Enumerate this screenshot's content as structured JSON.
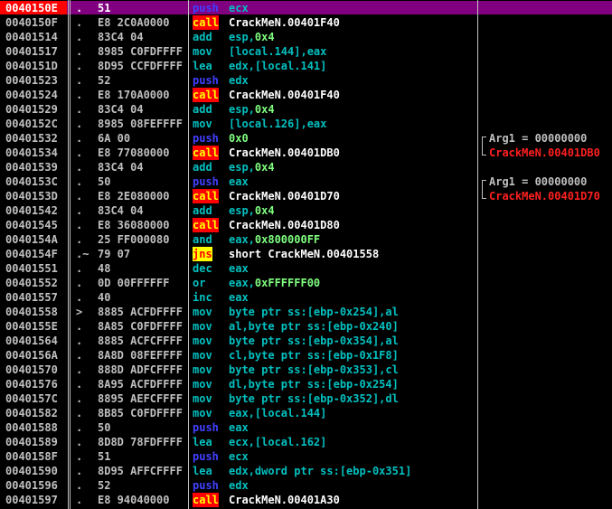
{
  "colors": {
    "background": "#000000",
    "selected_row": "#800080",
    "selected_address": "#ff0000",
    "call_highlight": "#ff0000",
    "jump_highlight": "#ffff00"
  },
  "rows": [
    {
      "addr": "0040150E",
      "mark": ".",
      "hex": "51",
      "mn": "push",
      "ops": [
        {
          "t": "ecx",
          "k": "reg"
        }
      ],
      "kind": "push",
      "selected": true
    },
    {
      "addr": "0040150F",
      "mark": ".",
      "hex": "E8 2C0A0000",
      "mn": "call",
      "ops": [
        {
          "t": "CrackMeN.00401F40",
          "k": "txt"
        }
      ],
      "kind": "call"
    },
    {
      "addr": "00401514",
      "mark": ".",
      "hex": "83C4 04",
      "mn": "add",
      "ops": [
        {
          "t": "esp,",
          "k": "reg"
        },
        {
          "t": "0x4",
          "k": "imm"
        }
      ],
      "kind": "add"
    },
    {
      "addr": "00401517",
      "mark": ".",
      "hex": "8985 C0FDFFFF",
      "mn": "mov",
      "ops": [
        {
          "t": "[local.144],",
          "k": "mem"
        },
        {
          "t": "eax",
          "k": "reg"
        }
      ],
      "kind": "mov"
    },
    {
      "addr": "0040151D",
      "mark": ".",
      "hex": "8D95 CCFDFFFF",
      "mn": "lea",
      "ops": [
        {
          "t": "edx,[local.141]",
          "k": "reg"
        }
      ],
      "kind": "lea"
    },
    {
      "addr": "00401523",
      "mark": ".",
      "hex": "52",
      "mn": "push",
      "ops": [
        {
          "t": "edx",
          "k": "reg"
        }
      ],
      "kind": "push"
    },
    {
      "addr": "00401524",
      "mark": ".",
      "hex": "E8 170A0000",
      "mn": "call",
      "ops": [
        {
          "t": "CrackMeN.00401F40",
          "k": "txt"
        }
      ],
      "kind": "call"
    },
    {
      "addr": "00401529",
      "mark": ".",
      "hex": "83C4 04",
      "mn": "add",
      "ops": [
        {
          "t": "esp,",
          "k": "reg"
        },
        {
          "t": "0x4",
          "k": "imm"
        }
      ],
      "kind": "add"
    },
    {
      "addr": "0040152C",
      "mark": ".",
      "hex": "8985 08FEFFFF",
      "mn": "mov",
      "ops": [
        {
          "t": "[local.126],",
          "k": "mem"
        },
        {
          "t": "eax",
          "k": "reg"
        }
      ],
      "kind": "mov"
    },
    {
      "addr": "00401532",
      "mark": ".",
      "hex": "6A 00",
      "mn": "push",
      "ops": [
        {
          "t": "0x0",
          "k": "imm"
        }
      ],
      "kind": "push"
    },
    {
      "addr": "00401534",
      "mark": ".",
      "hex": "E8 77080000",
      "mn": "call",
      "ops": [
        {
          "t": "CrackMeN.00401DB0",
          "k": "txt"
        }
      ],
      "kind": "call"
    },
    {
      "addr": "00401539",
      "mark": ".",
      "hex": "83C4 04",
      "mn": "add",
      "ops": [
        {
          "t": "esp,",
          "k": "reg"
        },
        {
          "t": "0x4",
          "k": "imm"
        }
      ],
      "kind": "add"
    },
    {
      "addr": "0040153C",
      "mark": ".",
      "hex": "50",
      "mn": "push",
      "ops": [
        {
          "t": "eax",
          "k": "reg"
        }
      ],
      "kind": "push"
    },
    {
      "addr": "0040153D",
      "mark": ".",
      "hex": "E8 2E080000",
      "mn": "call",
      "ops": [
        {
          "t": "CrackMeN.00401D70",
          "k": "txt"
        }
      ],
      "kind": "call"
    },
    {
      "addr": "00401542",
      "mark": ".",
      "hex": "83C4 04",
      "mn": "add",
      "ops": [
        {
          "t": "esp,",
          "k": "reg"
        },
        {
          "t": "0x4",
          "k": "imm"
        }
      ],
      "kind": "add"
    },
    {
      "addr": "00401545",
      "mark": ".",
      "hex": "E8 36080000",
      "mn": "call",
      "ops": [
        {
          "t": "CrackMeN.00401D80",
          "k": "txt"
        }
      ],
      "kind": "call"
    },
    {
      "addr": "0040154A",
      "mark": ".",
      "hex": "25 FF000080",
      "mn": "and",
      "ops": [
        {
          "t": "eax,",
          "k": "reg"
        },
        {
          "t": "0x800000FF",
          "k": "imm"
        }
      ],
      "kind": "and"
    },
    {
      "addr": "0040154F",
      "mark": ".~",
      "hex": "79 07",
      "mn": "jns",
      "ops": [
        {
          "t": "short CrackMeN.00401558",
          "k": "txt"
        }
      ],
      "kind": "jump"
    },
    {
      "addr": "00401551",
      "mark": ".",
      "hex": "48",
      "mn": "dec",
      "ops": [
        {
          "t": "eax",
          "k": "reg"
        }
      ],
      "kind": "dec"
    },
    {
      "addr": "00401552",
      "mark": ".",
      "hex": "0D 00FFFFFF",
      "mn": "or",
      "ops": [
        {
          "t": "eax,",
          "k": "reg"
        },
        {
          "t": "0xFFFFFF00",
          "k": "imm"
        }
      ],
      "kind": "or"
    },
    {
      "addr": "00401557",
      "mark": ".",
      "hex": "40",
      "mn": "inc",
      "ops": [
        {
          "t": "eax",
          "k": "reg"
        }
      ],
      "kind": "inc"
    },
    {
      "addr": "00401558",
      "mark": ">",
      "hex": "8885 ACFDFFFF",
      "mn": "mov",
      "ops": [
        {
          "t": "byte ptr ss:[ebp-0x254],al",
          "k": "mem"
        }
      ],
      "kind": "mov"
    },
    {
      "addr": "0040155E",
      "mark": ".",
      "hex": "8A85 C0FDFFFF",
      "mn": "mov",
      "ops": [
        {
          "t": "al,byte ptr ss:[ebp-0x240]",
          "k": "mem"
        }
      ],
      "kind": "mov"
    },
    {
      "addr": "00401564",
      "mark": ".",
      "hex": "8885 ACFCFFFF",
      "mn": "mov",
      "ops": [
        {
          "t": "byte ptr ss:[ebp-0x354],al",
          "k": "mem"
        }
      ],
      "kind": "mov"
    },
    {
      "addr": "0040156A",
      "mark": ".",
      "hex": "8A8D 08FEFFFF",
      "mn": "mov",
      "ops": [
        {
          "t": "cl,byte ptr ss:[ebp-0x1F8]",
          "k": "mem"
        }
      ],
      "kind": "mov"
    },
    {
      "addr": "00401570",
      "mark": ".",
      "hex": "888D ADFCFFFF",
      "mn": "mov",
      "ops": [
        {
          "t": "byte ptr ss:[ebp-0x353],cl",
          "k": "mem"
        }
      ],
      "kind": "mov"
    },
    {
      "addr": "00401576",
      "mark": ".",
      "hex": "8A95 ACFDFFFF",
      "mn": "mov",
      "ops": [
        {
          "t": "dl,byte ptr ss:[ebp-0x254]",
          "k": "mem"
        }
      ],
      "kind": "mov"
    },
    {
      "addr": "0040157C",
      "mark": ".",
      "hex": "8895 AEFCFFFF",
      "mn": "mov",
      "ops": [
        {
          "t": "byte ptr ss:[ebp-0x352],dl",
          "k": "mem"
        }
      ],
      "kind": "mov"
    },
    {
      "addr": "00401582",
      "mark": ".",
      "hex": "8B85 C0FDFFFF",
      "mn": "mov",
      "ops": [
        {
          "t": "eax,[local.144]",
          "k": "reg"
        }
      ],
      "kind": "mov"
    },
    {
      "addr": "00401588",
      "mark": ".",
      "hex": "50",
      "mn": "push",
      "ops": [
        {
          "t": "eax",
          "k": "reg"
        }
      ],
      "kind": "push"
    },
    {
      "addr": "00401589",
      "mark": ".",
      "hex": "8D8D 78FDFFFF",
      "mn": "lea",
      "ops": [
        {
          "t": "ecx,[local.162]",
          "k": "reg"
        }
      ],
      "kind": "lea"
    },
    {
      "addr": "0040158F",
      "mark": ".",
      "hex": "51",
      "mn": "push",
      "ops": [
        {
          "t": "ecx",
          "k": "reg"
        }
      ],
      "kind": "push"
    },
    {
      "addr": "00401590",
      "mark": ".",
      "hex": "8D95 AFFCFFFF",
      "mn": "lea",
      "ops": [
        {
          "t": "edx,dword ptr ss:[ebp-0x351]",
          "k": "reg"
        }
      ],
      "kind": "lea"
    },
    {
      "addr": "00401596",
      "mark": ".",
      "hex": "52",
      "mn": "push",
      "ops": [
        {
          "t": "edx",
          "k": "reg"
        }
      ],
      "kind": "push"
    },
    {
      "addr": "00401597",
      "mark": ".",
      "hex": "E8 94040000",
      "mn": "call",
      "ops": [
        {
          "t": "CrackMeN.00401A30",
          "k": "txt"
        }
      ],
      "kind": "call"
    }
  ],
  "comments": [
    {
      "row": 9,
      "arg": "Arg1 = 00000000",
      "target": "CrackMeN.00401DB0"
    },
    {
      "row": 12,
      "arg": "Arg1 = 00000000",
      "target": "CrackMeN.00401D70"
    }
  ]
}
